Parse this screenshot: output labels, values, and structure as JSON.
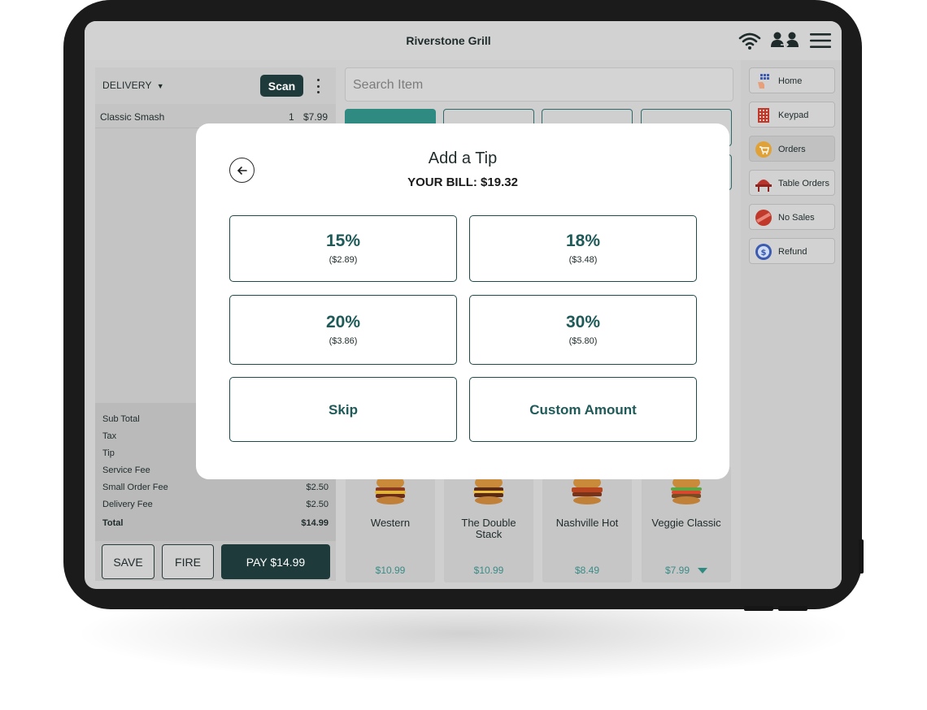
{
  "header": {
    "title": "Riverstone Grill",
    "icons": [
      "wifi-icon",
      "switch-user-icon",
      "menu-icon"
    ]
  },
  "order": {
    "type_label": "DELIVERY",
    "scan_label": "Scan",
    "items": [
      {
        "name": "Classic Smash",
        "qty": "1",
        "price": "$7.99"
      }
    ],
    "totals": [
      {
        "label": "Sub Total",
        "value": ""
      },
      {
        "label": "Tax",
        "value": ""
      },
      {
        "label": "Tip",
        "value": ""
      },
      {
        "label": "Service Fee",
        "value": ""
      },
      {
        "label": "Small Order Fee",
        "value": "$2.50"
      },
      {
        "label": "Delivery Fee",
        "value": "$2.50"
      },
      {
        "label": "Total",
        "value": "$14.99"
      }
    ],
    "actions": {
      "save": "SAVE",
      "fire": "FIRE",
      "pay": "PAY $14.99"
    }
  },
  "search": {
    "placeholder": "Search Item"
  },
  "menu_items": [
    {
      "name": "Western",
      "price": "$10.99"
    },
    {
      "name": "The Double Stack",
      "price": "$10.99"
    },
    {
      "name": "Nashville Hot",
      "price": "$8.49"
    },
    {
      "name": "Veggie Classic",
      "price": "$7.99"
    }
  ],
  "nav": [
    {
      "label": "Home",
      "icon": "home-icon"
    },
    {
      "label": "Keypad",
      "icon": "keypad-icon"
    },
    {
      "label": "Orders",
      "icon": "orders-icon",
      "active": true
    },
    {
      "label": "Table Orders",
      "icon": "table-orders-icon"
    },
    {
      "label": "No Sales",
      "icon": "no-sales-icon"
    },
    {
      "label": "Refund",
      "icon": "refund-icon"
    }
  ],
  "tip_modal": {
    "title": "Add a Tip",
    "bill": "YOUR BILL: $19.32",
    "options": [
      {
        "pct": "15%",
        "amount": "($2.89)"
      },
      {
        "pct": "18%",
        "amount": "($3.48)"
      },
      {
        "pct": "20%",
        "amount": "($3.86)"
      },
      {
        "pct": "30%",
        "amount": "($5.80)"
      }
    ],
    "skip": "Skip",
    "custom": "Custom Amount"
  },
  "colors": {
    "brand_dark": "#1e3a3a",
    "accent_teal": "#2f8b82",
    "price_teal": "#3c8b86"
  }
}
